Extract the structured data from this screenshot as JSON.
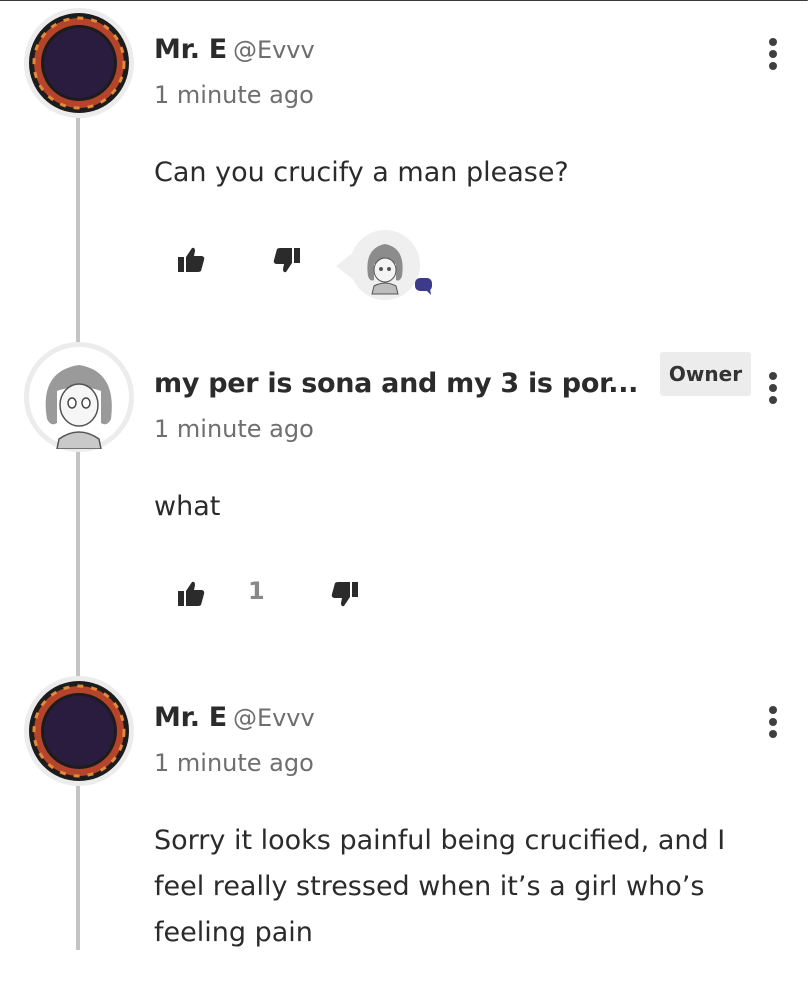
{
  "comments": [
    {
      "display_name": "Mr. E",
      "handle": "@Evvv",
      "timestamp": "1 minute ago",
      "text": "Can you crucify a man please?",
      "avatar": "dark-purple-ring-avatar"
    },
    {
      "display_name": "my per is sona and my 3 is por...",
      "badge": "Owner",
      "timestamp": "1 minute ago",
      "text": "what",
      "like_count": "1",
      "avatar": "grey-haired-character-avatar"
    },
    {
      "display_name": "Mr. E",
      "handle": "@Evvv",
      "timestamp": "1 minute ago",
      "text": "Sorry it looks painful being crucified, and I feel really stressed when it’s a girl who’s feeling pain",
      "avatar": "dark-purple-ring-avatar"
    }
  ],
  "colors": {
    "accent_chat": "#3d3a8c",
    "thread_line": "#c4c4c4",
    "avatar_ring": "#b5442a",
    "avatar_inner": "#2a1c3e"
  }
}
